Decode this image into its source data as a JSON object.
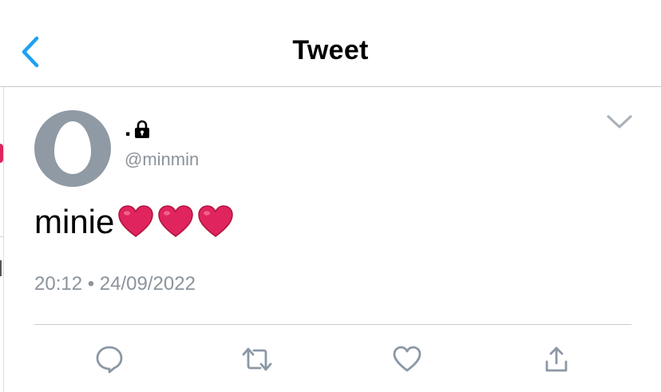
{
  "header": {
    "title": "Tweet",
    "back_icon": "chevron-left-icon",
    "accent": "#1da1f2"
  },
  "tweet": {
    "display_name": ".",
    "protected_icon": "lock-icon",
    "handle": "@minmin",
    "text": "minie",
    "emojis": [
      "red-heart",
      "red-heart",
      "red-heart"
    ],
    "timestamp": "20:12 • 24/09/2022",
    "menu_icon": "chevron-down-icon"
  },
  "actions": [
    {
      "name": "reply",
      "icon": "comment-icon"
    },
    {
      "name": "retweet",
      "icon": "retweet-icon"
    },
    {
      "name": "like",
      "icon": "heart-outline-icon"
    },
    {
      "name": "share",
      "icon": "share-icon"
    }
  ],
  "colors": {
    "secondary_text": "#8b939b",
    "icon_gray": "#657786",
    "heart": "#e0245e",
    "avatar_bg": "#8f9aa5"
  }
}
